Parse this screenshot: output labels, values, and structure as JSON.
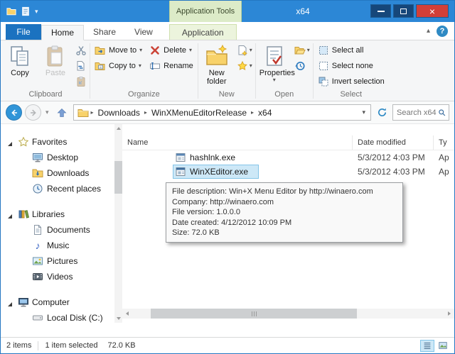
{
  "icons": {
    "chevron_down": "▾",
    "chevron_up": "▴",
    "breadcrumb_arrow": "▸",
    "help": "?",
    "close": "×",
    "music_note": "♪"
  },
  "colors": {
    "titlebar_blue": "#2c87d6",
    "contextual_green_bg": "#dcebc8",
    "file_button_blue": "#1b72c0",
    "selection_bg": "#cde8f7",
    "selection_border": "#84c5e8",
    "close_button_red": "#d23f38",
    "help_circle_blue": "#2f8ac4"
  },
  "titlebar": {
    "title": "x64",
    "contextual_group_label": "Application Tools"
  },
  "tabs": {
    "file": "File",
    "home": "Home",
    "share": "Share",
    "view": "View",
    "application": "Application"
  },
  "ribbon": {
    "clipboard": {
      "group_label": "Clipboard",
      "copy": "Copy",
      "paste": "Paste"
    },
    "organize": {
      "group_label": "Organize",
      "move_to": "Move to",
      "copy_to": "Copy to",
      "delete": "Delete",
      "rename": "Rename"
    },
    "new": {
      "group_label": "New",
      "new_folder": "New folder"
    },
    "open": {
      "group_label": "Open",
      "properties": "Properties"
    },
    "select": {
      "group_label": "Select",
      "select_all": "Select all",
      "select_none": "Select none",
      "invert_selection": "Invert selection"
    }
  },
  "addressbar": {
    "crumbs": [
      "Downloads",
      "WinXMenuEditorRelease",
      "x64"
    ],
    "search_placeholder": "Search x64"
  },
  "sidebar": {
    "favorites": {
      "label": "Favorites",
      "items": [
        "Desktop",
        "Downloads",
        "Recent places"
      ]
    },
    "libraries": {
      "label": "Libraries",
      "items": [
        "Documents",
        "Music",
        "Pictures",
        "Videos"
      ]
    },
    "computer": {
      "label": "Computer",
      "items": [
        "Local Disk (C:)"
      ]
    }
  },
  "filelist": {
    "columns": {
      "name": "Name",
      "date_modified": "Date modified",
      "type": "Ty"
    },
    "rows": [
      {
        "name": "hashlnk.exe",
        "date_modified": "5/3/2012 4:03 PM",
        "type": "Ap"
      },
      {
        "name": "WinXEditor.exe",
        "date_modified": "5/3/2012 4:03 PM",
        "type": "Ap"
      }
    ]
  },
  "tooltip": {
    "line1": "File description: Win+X Menu Editor by http://winaero.com",
    "line2": "Company: http://winaero.com",
    "line3": "File version: 1.0.0.0",
    "line4": "Date created: 4/12/2012 10:09 PM",
    "line5": "Size: 72.0 KB"
  },
  "statusbar": {
    "items_count": "2 items",
    "selected": "1 item selected",
    "size": "72.0 KB"
  }
}
